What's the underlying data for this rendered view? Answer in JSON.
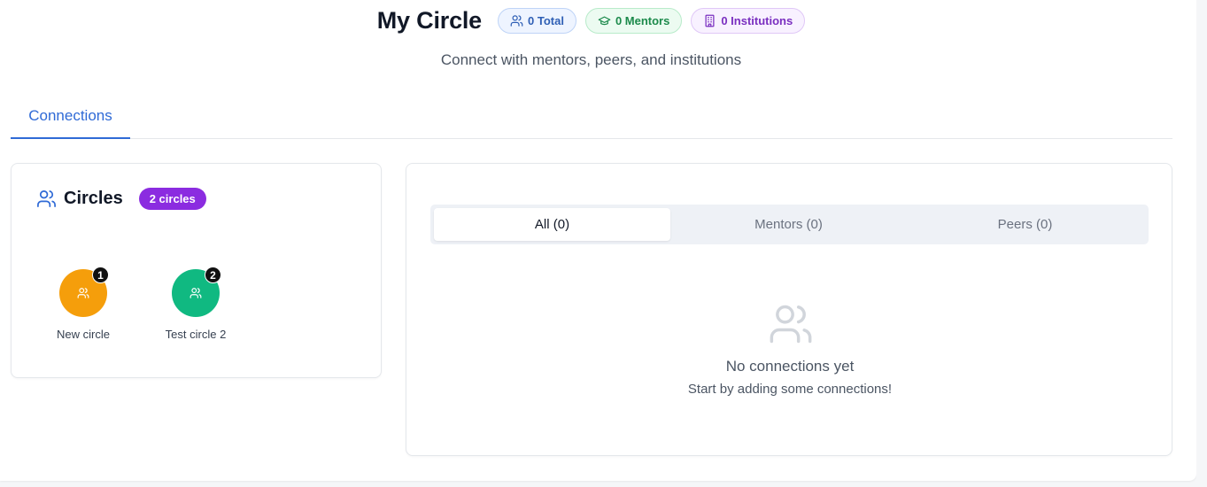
{
  "header": {
    "title": "My Circle",
    "subtitle": "Connect with mentors, peers, and institutions",
    "stats": {
      "total": "0 Total",
      "mentors": "0 Mentors",
      "institutions": "0 Institutions"
    }
  },
  "tabs": [
    {
      "label": "Connections",
      "active": true
    }
  ],
  "circles": {
    "title": "Circles",
    "count_badge": "2 circles",
    "items": [
      {
        "name": "New circle",
        "count": "1",
        "color": "#f59e0b"
      },
      {
        "name": "Test circle 2",
        "count": "2",
        "color": "#10b981"
      }
    ]
  },
  "connections": {
    "filters": [
      {
        "label": "All (0)",
        "active": true
      },
      {
        "label": "Mentors (0)",
        "active": false
      },
      {
        "label": "Peers (0)",
        "active": false
      }
    ],
    "empty_title": "No connections yet",
    "empty_subtitle": "Start by adding some connections!"
  },
  "colors": {
    "accent": "#2f6ad6",
    "purple_badge": "#8b2ce0"
  },
  "icons": {
    "total": "users-icon",
    "mentors": "graduation-cap-icon",
    "institutions": "building-icon",
    "circles": "users-icon",
    "empty": "users-icon"
  }
}
